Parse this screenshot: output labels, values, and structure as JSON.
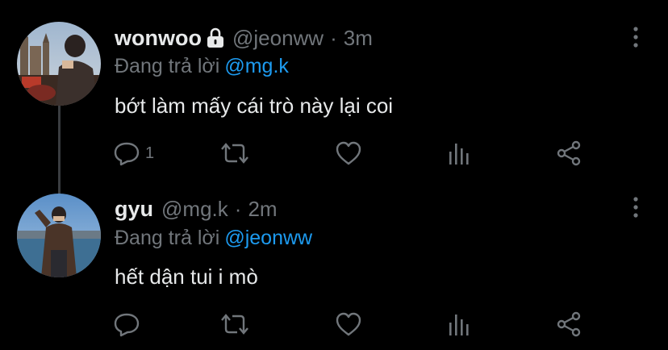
{
  "colors": {
    "background": "#000000",
    "text": "#e7e9ea",
    "muted": "#71767b",
    "accent": "#1d9bf0",
    "thread_line": "#3a3d41"
  },
  "tweets": [
    {
      "display_name": "wonwoo",
      "protected": true,
      "protected_icon": "lock-icon",
      "handle": "@jeonww",
      "separator": "·",
      "time": "3m",
      "reply_prefix": "Đang trả lời",
      "reply_to": "@mg.k",
      "text": "bớt làm mấy cái trò này lại coi",
      "reply_count": "1",
      "actions": [
        "reply-icon",
        "retweet-icon",
        "like-icon",
        "stats-icon",
        "share-icon"
      ]
    },
    {
      "display_name": "gyu",
      "protected": false,
      "handle": "@mg.k",
      "separator": "·",
      "time": "2m",
      "reply_prefix": "Đang trả lời",
      "reply_to": "@jeonww",
      "text": "hết dận tui i mò",
      "reply_count": "",
      "actions": [
        "reply-icon",
        "retweet-icon",
        "like-icon",
        "stats-icon",
        "share-icon"
      ]
    }
  ]
}
